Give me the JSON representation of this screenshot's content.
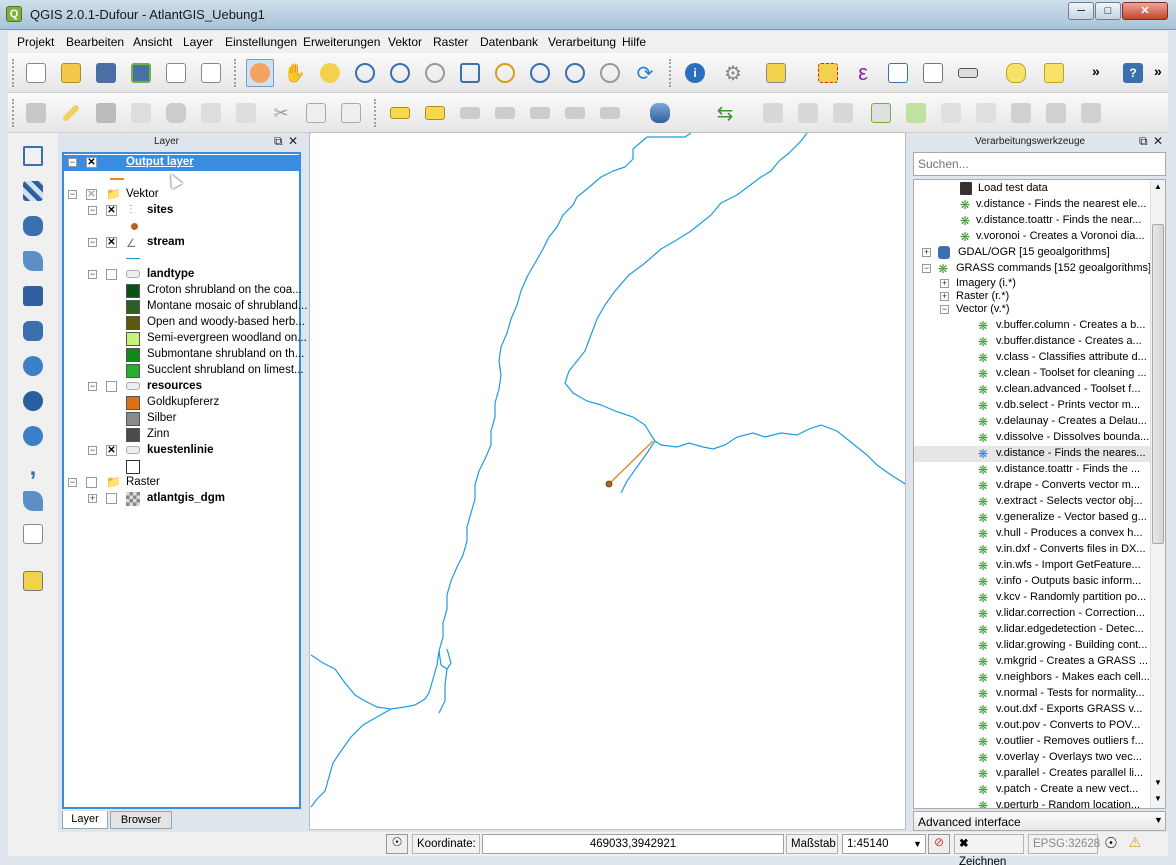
{
  "window": {
    "title": "QGIS 2.0.1-Dufour - AtlantGIS_Uebung1",
    "app_icon": "qgis-icon"
  },
  "menu": [
    "Projekt",
    "Bearbeiten",
    "Ansicht",
    "Layer",
    "Einstellungen",
    "Erweiterungen",
    "Vektor",
    "Raster",
    "Datenbank",
    "Verarbeitung",
    "Hilfe"
  ],
  "layers_panel": {
    "title": "Layer",
    "items": [
      {
        "name": "Output layer",
        "checked": true,
        "selected": true
      },
      {
        "name": "Vektor",
        "group": true
      },
      {
        "name": "sites",
        "checked": true
      },
      {
        "name": "stream",
        "checked": true
      },
      {
        "name": "landtype",
        "checked": false
      },
      {
        "name": "Croton shrubland on the coa...",
        "color": "#0b4f12"
      },
      {
        "name": "Montane mosaic of shrubland...",
        "color": "#2c5f22"
      },
      {
        "name": "Open and woody-based herb...",
        "color": "#5a5a0a"
      },
      {
        "name": "Semi-evergreen woodland on...",
        "color": "#c6f47a"
      },
      {
        "name": "Submontane shrubland on th...",
        "color": "#0f8a18"
      },
      {
        "name": "Succlent shrubland on limest...",
        "color": "#25b02a"
      },
      {
        "name": "resources",
        "checked": false
      },
      {
        "name": "Goldkupfererz",
        "color": "#e07010"
      },
      {
        "name": "Silber",
        "color": "#8a8a8a"
      },
      {
        "name": "Zinn",
        "color": "#4a4a4a"
      },
      {
        "name": "kuestenlinie",
        "checked": true
      },
      {
        "name": "Raster",
        "group": true
      },
      {
        "name": "atlantgis_dgm",
        "checked": false
      }
    ],
    "tabs": [
      "Layer",
      "Browser"
    ]
  },
  "processing_panel": {
    "title": "Verarbeitungswerkzeuge",
    "search_placeholder": "Suchen...",
    "items": [
      "Load test data",
      "v.distance - Finds the nearest ele...",
      "v.distance.toattr - Finds the near...",
      "v.voronoi - Creates a Voronoi dia...",
      "GDAL/OGR [15 geoalgorithms]",
      "GRASS commands [152 geoalgorithms]",
      "Imagery (i.*)",
      "Raster (r.*)",
      "Vector (v.*)",
      "v.buffer.column - Creates a b...",
      "v.buffer.distance - Creates a...",
      "v.class - Classifies attribute d...",
      "v.clean - Toolset for cleaning ...",
      "v.clean.advanced - Toolset f...",
      "v.db.select - Prints vector m...",
      "v.delaunay - Creates a Delau...",
      "v.dissolve - Dissolves bounda...",
      "v.distance - Finds the neares...",
      "v.distance.toattr - Finds the ...",
      "v.drape - Converts vector m...",
      "v.extract - Selects vector obj...",
      "v.generalize - Vector based g...",
      "v.hull - Produces a convex h...",
      "v.in.dxf - Converts files in DX...",
      "v.in.wfs - Import GetFeature...",
      "v.info - Outputs basic inform...",
      "v.kcv - Randomly partition po...",
      "v.lidar.correction - Correction...",
      "v.lidar.edgedetection - Detec...",
      "v.lidar.growing - Building cont...",
      "v.mkgrid - Creates a GRASS ...",
      "v.neighbors - Makes each cell...",
      "v.normal - Tests for normality...",
      "v.out.dxf - Exports GRASS v...",
      "v.out.pov - Converts to POV...",
      "v.outlier - Removes outliers f...",
      "v.overlay - Overlays two vec...",
      "v.parallel - Creates parallel li...",
      "v.patch - Create a new vect...",
      "v.perturb - Random location..."
    ],
    "advanced": "Advanced interface"
  },
  "statusbar": {
    "koordinate_label": "Koordinate:",
    "koordinate_value": "469033,3942921",
    "massstab_label": "Maßstab",
    "massstab_value": "1:45140",
    "zeichnen": "Zeichnen",
    "epsg": "EPSG:32628"
  },
  "colors": {
    "stream": "#1e9be0",
    "distance_line": "#e08b2a",
    "site_point": "#b5651d",
    "selection": "#3b8be0"
  }
}
